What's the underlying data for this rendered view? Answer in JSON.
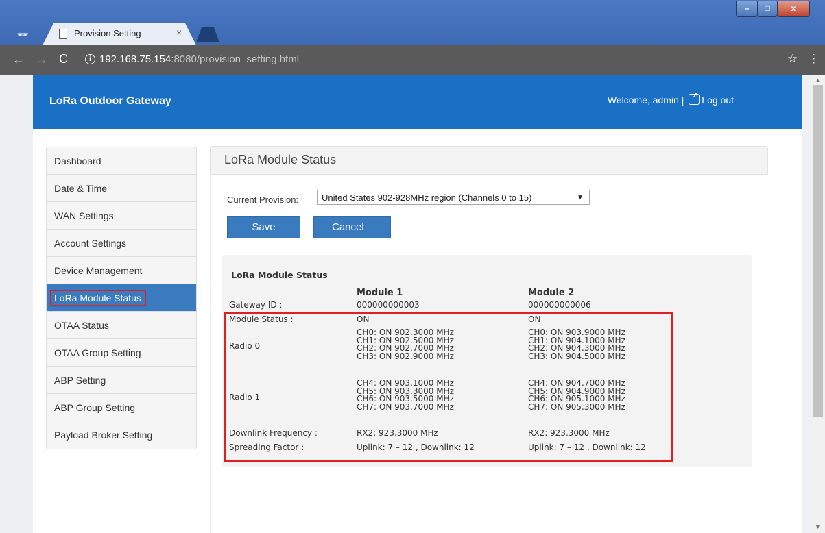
{
  "browser": {
    "tab_title": "Provision Setting",
    "tab_close": "×",
    "url_host": "192.168.75.154",
    "url_rest": ":8080/provision_setting.html",
    "window_controls": {
      "minimize": "–",
      "maximize": "□",
      "close": "x"
    }
  },
  "header": {
    "title": "LoRa Outdoor Gateway",
    "welcome": "Welcome, admin |",
    "logout": "Log out"
  },
  "sidebar": {
    "items": [
      {
        "label": "Dashboard"
      },
      {
        "label": "Date & Time"
      },
      {
        "label": "WAN Settings"
      },
      {
        "label": "Account Settings"
      },
      {
        "label": "Device Management"
      },
      {
        "label": "LoRa Module Status"
      },
      {
        "label": "OTAA Status"
      },
      {
        "label": "OTAA Group Setting"
      },
      {
        "label": "ABP Setting"
      },
      {
        "label": "ABP Group Setting"
      },
      {
        "label": "Payload Broker Setting"
      }
    ],
    "active_index": 5
  },
  "content": {
    "title": "LoRa Module Status",
    "provision_label": "Current Provision:",
    "provision_value": "United States 902-928MHz region (Channels 0 to 15)",
    "save_label": "Save",
    "cancel_label": "Cancel"
  },
  "status": {
    "title": "LoRa Module Status",
    "columns": [
      "Module 1",
      "Module 2"
    ],
    "gateway_id_label": "Gateway ID :",
    "gateway_ids": [
      "000000000003",
      "000000000006"
    ],
    "module_status_label": "Module Status :",
    "module_status": [
      "ON",
      "ON"
    ],
    "radio0_label": "Radio 0",
    "radio0": [
      [
        "CH0: ON 902.3000 MHz",
        "CH1: ON 902.5000 MHz",
        "CH2: ON 902.7000 MHz",
        "CH3: ON 902.9000 MHz"
      ],
      [
        "CH0: ON 903.9000 MHz",
        "CH1: ON 904.1000 MHz",
        "CH2: ON 904.3000 MHz",
        "CH3: ON 904.5000 MHz"
      ]
    ],
    "radio1_label": "Radio 1",
    "radio1": [
      [
        "CH4: ON 903.1000 MHz",
        "CH5: ON 903.3000 MHz",
        "CH6: ON 903.5000 MHz",
        "CH7: ON 903.7000 MHz"
      ],
      [
        "CH4: ON 904.7000 MHz",
        "CH5: ON 904.9000 MHz",
        "CH6: ON 905.1000 MHz",
        "CH7: ON 905.3000 MHz"
      ]
    ],
    "downlink_label": "Downlink Frequency :",
    "downlink": [
      "RX2: 923.3000 MHz",
      "RX2: 923.3000 MHz"
    ],
    "sf_label": "Spreading Factor :",
    "sf": [
      "Uplink: 7 – 12 , Downlink: 12",
      "Uplink: 7 – 12 , Downlink: 12"
    ]
  },
  "colors": {
    "header_blue": "#1a70c4",
    "button_blue": "#3a7bbf",
    "highlight_red": "#e02020"
  }
}
